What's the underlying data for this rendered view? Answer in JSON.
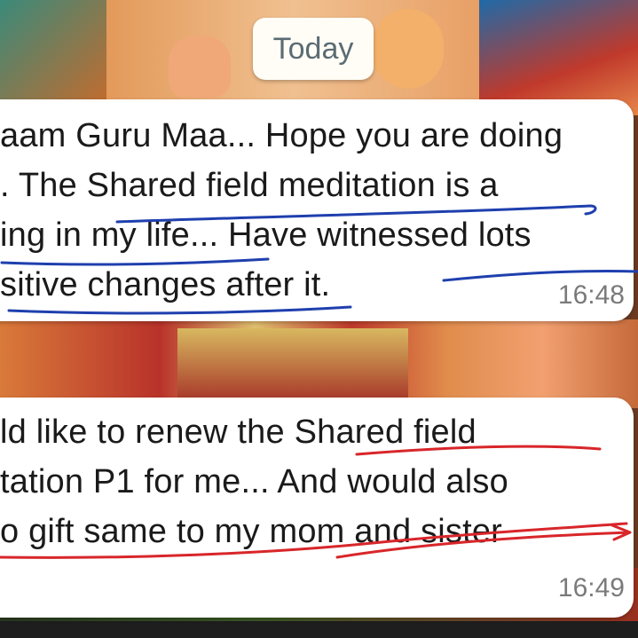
{
  "date_chip": "Today",
  "messages": [
    {
      "lines": [
        "aam Guru Maa... Hope you are doing",
        ". The Shared field meditation is a",
        "ing in my life... Have witnessed lots",
        "sitive changes after it."
      ],
      "time": "16:48"
    },
    {
      "lines": [
        "ld like to renew the Shared field",
        "tation P1 for me... And would also",
        "o gift same to my mom and sister"
      ],
      "time": "16:49"
    }
  ],
  "annotation_colors": {
    "blue_underline": "#1f3fae",
    "red_underline": "#d8262a"
  }
}
